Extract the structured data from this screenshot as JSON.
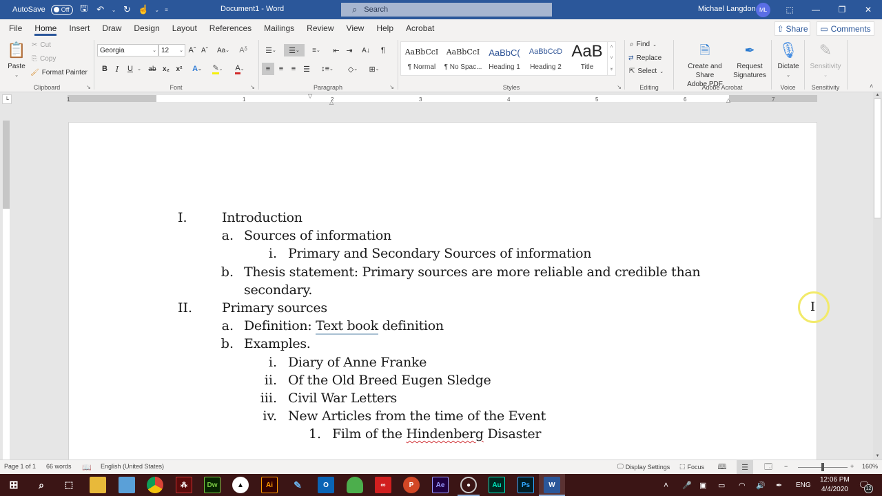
{
  "titlebar": {
    "autosave_label": "AutoSave",
    "autosave_state": "Off",
    "doc_title": "Document1  -  Word",
    "search_placeholder": "Search",
    "user_name": "Michael Langdon",
    "user_initials": "ML"
  },
  "menu": {
    "tabs": [
      "File",
      "Home",
      "Insert",
      "Draw",
      "Design",
      "Layout",
      "References",
      "Mailings",
      "Review",
      "View",
      "Help",
      "Acrobat"
    ],
    "active_tab": "Home",
    "share_label": "Share",
    "comments_label": "Comments"
  },
  "ribbon": {
    "clipboard": {
      "paste": "Paste",
      "cut": "Cut",
      "copy": "Copy",
      "format_painter": "Format Painter",
      "label": "Clipboard"
    },
    "font": {
      "name": "Georgia",
      "size": "12",
      "label": "Font",
      "bold": "B",
      "italic": "I",
      "underline": "U",
      "change_case": "Aa"
    },
    "paragraph": {
      "label": "Paragraph",
      "show_marks": "¶"
    },
    "styles": {
      "label": "Styles",
      "items": [
        {
          "sample": "AaBbCcI",
          "name": "¶ Normal"
        },
        {
          "sample": "AaBbCcI",
          "name": "¶ No Spac..."
        },
        {
          "sample": "AaBbC(",
          "name": "Heading 1"
        },
        {
          "sample": "AaBbCcD",
          "name": "Heading 2"
        },
        {
          "sample": "AaB",
          "name": "Title"
        }
      ]
    },
    "editing": {
      "label": "Editing",
      "find": "Find",
      "replace": "Replace",
      "select": "Select"
    },
    "acrobat": {
      "label": "Adobe Acrobat",
      "create_line1": "Create and Share",
      "create_line2": "Adobe PDF",
      "request_line1": "Request",
      "request_line2": "Signatures"
    },
    "voice": {
      "label": "Voice",
      "dictate": "Dictate"
    },
    "sensitivity": {
      "label": "Sensitivity",
      "button": "Sensitivity"
    }
  },
  "ruler": {
    "numbers": [
      "1",
      "1",
      "2",
      "3",
      "4",
      "5",
      "6",
      "7"
    ]
  },
  "document": {
    "lines": [
      {
        "marker": "I.",
        "text": "Introduction",
        "level": 0
      },
      {
        "marker": "a.",
        "text": "Sources of information",
        "level": 1
      },
      {
        "marker": "i.",
        "text": "Primary and Secondary Sources of information",
        "level": 2
      },
      {
        "marker": "b.",
        "text": "Thesis statement: Primary sources are more reliable and credible than",
        "level": 1
      },
      {
        "marker": "",
        "text": "secondary.",
        "level": 1
      },
      {
        "marker": "II.",
        "text": "Primary sources",
        "level": 0
      },
      {
        "marker": "a.",
        "text_before": "Definition: ",
        "text_grammar": "Text book",
        "text_after": " definition",
        "level": 1
      },
      {
        "marker": "b.",
        "text": "Examples.",
        "level": 1
      },
      {
        "marker": "i.",
        "text": "Diary of Anne Franke",
        "level": 2
      },
      {
        "marker": "ii.",
        "text": "Of the Old Breed Eugen Sledge",
        "level": 2
      },
      {
        "marker": "iii.",
        "text": "Civil War Letters",
        "level": 2
      },
      {
        "marker": "iv.",
        "text": "New Articles from the time of the Event",
        "level": 2
      },
      {
        "marker": "1.",
        "text_before": "Film of the ",
        "text_spell": "Hindenberg",
        "text_after": " Disaster",
        "level": 3
      }
    ]
  },
  "statusbar": {
    "page": "Page 1 of 1",
    "words": "66 words",
    "language": "English (United States)",
    "display_settings": "Display Settings",
    "focus": "Focus",
    "zoom": "160%",
    "zoom_minus": "−",
    "zoom_plus": "+"
  },
  "taskbar": {
    "apps": [
      "Start",
      "Search",
      "Task View",
      "File Explorer",
      "Control Panel",
      "Chrome",
      "Acrobat",
      "Dreamweaver",
      "Inkscape",
      "Illustrator",
      "Paint Tool",
      "Outlook",
      "Android",
      "Creative Cloud",
      "PowerPoint",
      "After Effects",
      "OBS",
      "Audition",
      "Photoshop",
      "Word"
    ],
    "language": "ENG",
    "time": "12:06 PM",
    "date": "4/4/2020",
    "notifications": "12"
  },
  "colors": {
    "brand": "#2b579a",
    "taskbar": "#3b1515",
    "cursor_highlight": "#f2ea6a"
  }
}
